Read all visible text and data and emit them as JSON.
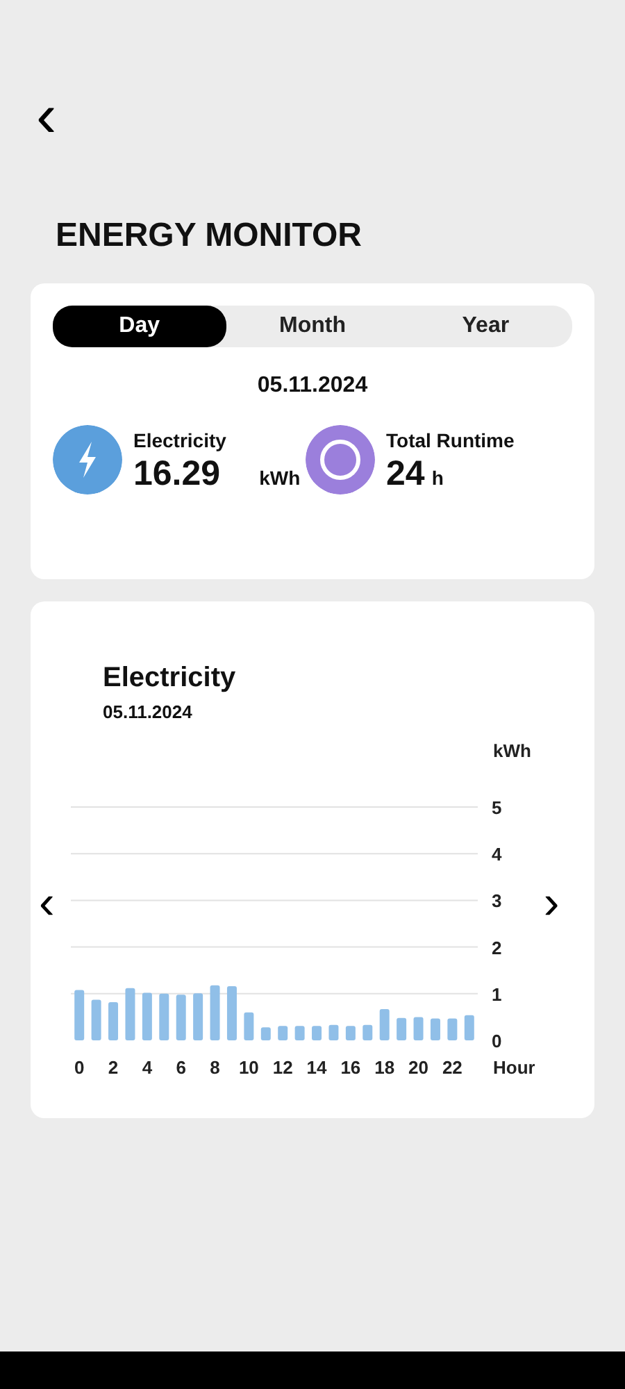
{
  "header": {
    "back": "‹",
    "title": "ENERGY MONITOR"
  },
  "tabs": [
    {
      "label": "Day",
      "selected": true
    },
    {
      "label": "Month",
      "selected": false
    },
    {
      "label": "Year",
      "selected": false
    }
  ],
  "date": "05.11.2024",
  "stats": [
    {
      "kind": "electricity",
      "label": "Electricity",
      "value": "16.29",
      "unit": "kWh"
    },
    {
      "kind": "runtime",
      "label": "Total Runtime",
      "value": "24",
      "unit": "h"
    }
  ],
  "chart_card": {
    "date": "05.11.2024",
    "prev": "‹",
    "next": "›",
    "chart_data": {
      "type": "bar",
      "title": "Electricity",
      "xlabel": "Hour",
      "ylabel": "kWh",
      "grid": true,
      "x": [
        0,
        1,
        2,
        3,
        4,
        5,
        6,
        7,
        8,
        9,
        10,
        11,
        12,
        13,
        14,
        15,
        16,
        17,
        18,
        19,
        20,
        21,
        22,
        23
      ],
      "series": [
        {
          "color": "#90bfe8",
          "values": [
            1.08,
            0.87,
            0.82,
            1.12,
            1.02,
            1.0,
            0.98,
            1.01,
            1.18,
            1.16,
            0.6,
            0.28,
            0.31,
            0.31,
            0.31,
            0.33,
            0.31,
            0.33,
            0.67,
            0.48,
            0.5,
            0.47,
            0.47,
            0.54
          ]
        }
      ],
      "xlim": [
        -0.5,
        23.5
      ],
      "ylim": [
        0,
        5
      ],
      "yticks": [
        0,
        1,
        2,
        3,
        4,
        5
      ],
      "xticks": [
        0,
        2,
        4,
        6,
        8,
        10,
        12,
        14,
        16,
        18,
        20,
        22
      ]
    }
  }
}
